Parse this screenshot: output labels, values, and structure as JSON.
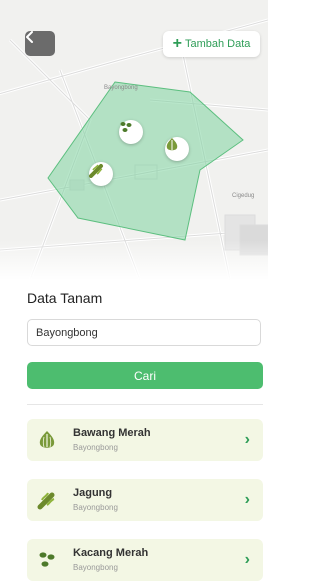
{
  "header": {
    "back_icon": "chevron-left-icon",
    "add_button_label": "Tambah Data",
    "add_icon": "plus-icon"
  },
  "map": {
    "labels": {
      "area_name": "Bayongbong",
      "district_right": "Cigedug"
    },
    "polygon_color": "#7fd4a0",
    "markers": [
      "kacang-merah-marker",
      "bawang-merah-marker",
      "jagung-marker"
    ]
  },
  "section": {
    "title": "Data Tanam"
  },
  "search": {
    "value": "Bayongbong",
    "button_label": "Cari"
  },
  "results": [
    {
      "name": "Bawang Merah",
      "location": "Bayongbong",
      "icon": "onion-icon"
    },
    {
      "name": "Jagung",
      "location": "Bayongbong",
      "icon": "corn-icon"
    },
    {
      "name": "Kacang Merah",
      "location": "Bayongbong",
      "icon": "bean-icon"
    }
  ],
  "colors": {
    "accent": "#4dbd6f",
    "accent_dark": "#2e9d57",
    "card_bg": "#f3f7e4"
  }
}
